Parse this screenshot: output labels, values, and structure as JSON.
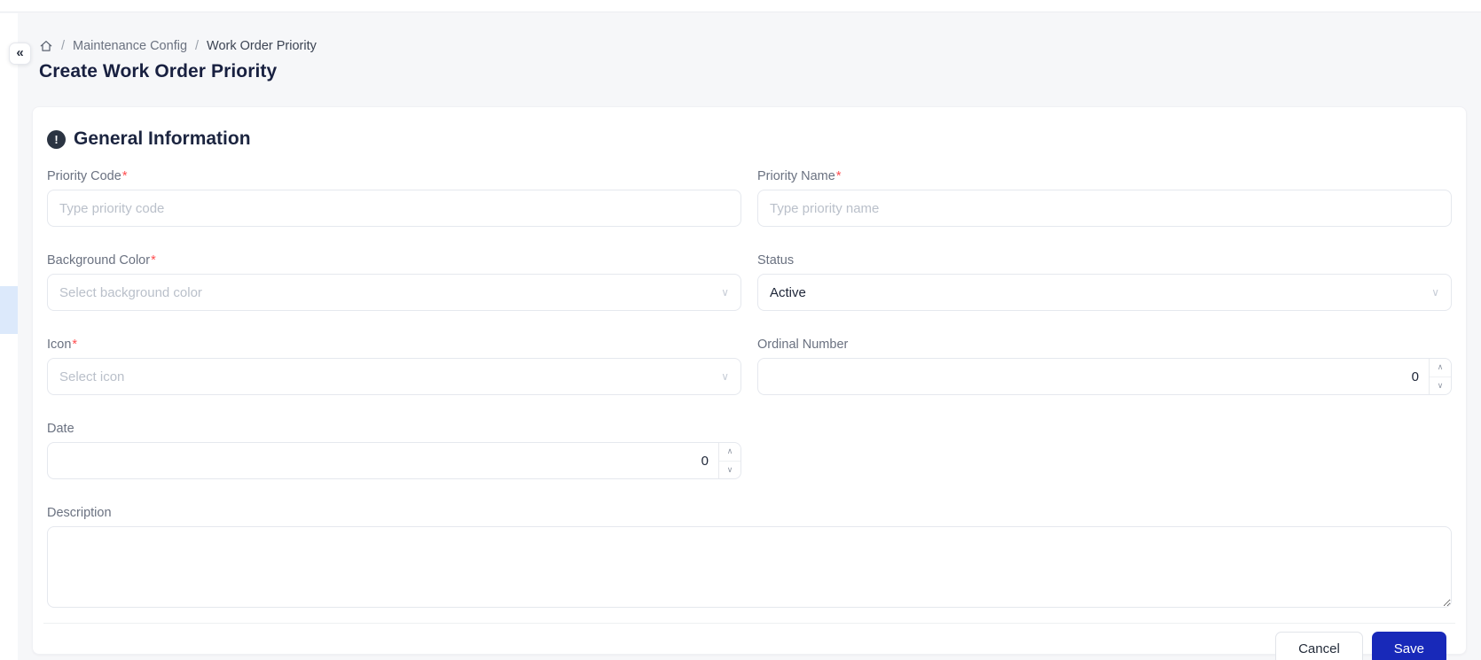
{
  "icons": {
    "collapse": "«",
    "chevron_down": "∨",
    "chevron_up": "∧",
    "info": "!"
  },
  "marks": {
    "required": "*"
  },
  "breadcrumb": {
    "separator": "/",
    "items": [
      {
        "label": "Maintenance Config"
      },
      {
        "label": "Work Order Priority"
      }
    ]
  },
  "page_title": "Create Work Order Priority",
  "section": {
    "title": "General Information"
  },
  "form": {
    "priority_code": {
      "label": "Priority Code",
      "required": true,
      "placeholder": "Type priority code",
      "value": ""
    },
    "priority_name": {
      "label": "Priority Name",
      "required": true,
      "placeholder": "Type priority name",
      "value": ""
    },
    "background_color": {
      "label": "Background Color",
      "required": true,
      "placeholder": "Select background color",
      "value": ""
    },
    "status": {
      "label": "Status",
      "required": false,
      "value": "Active"
    },
    "icon": {
      "label": "Icon",
      "required": true,
      "placeholder": "Select icon",
      "value": ""
    },
    "ordinal_number": {
      "label": "Ordinal Number",
      "required": false,
      "value": "0"
    },
    "date": {
      "label": "Date",
      "required": false,
      "value": "0"
    },
    "description": {
      "label": "Description",
      "required": false,
      "value": ""
    }
  },
  "footer": {
    "cancel": "Cancel",
    "save": "Save"
  },
  "colors": {
    "save_button_bg": "#1829b9",
    "required_mark": "#ff4d4f",
    "sidebar_active_bg": "#dce9fb",
    "page_bg": "#f6f7f9"
  }
}
